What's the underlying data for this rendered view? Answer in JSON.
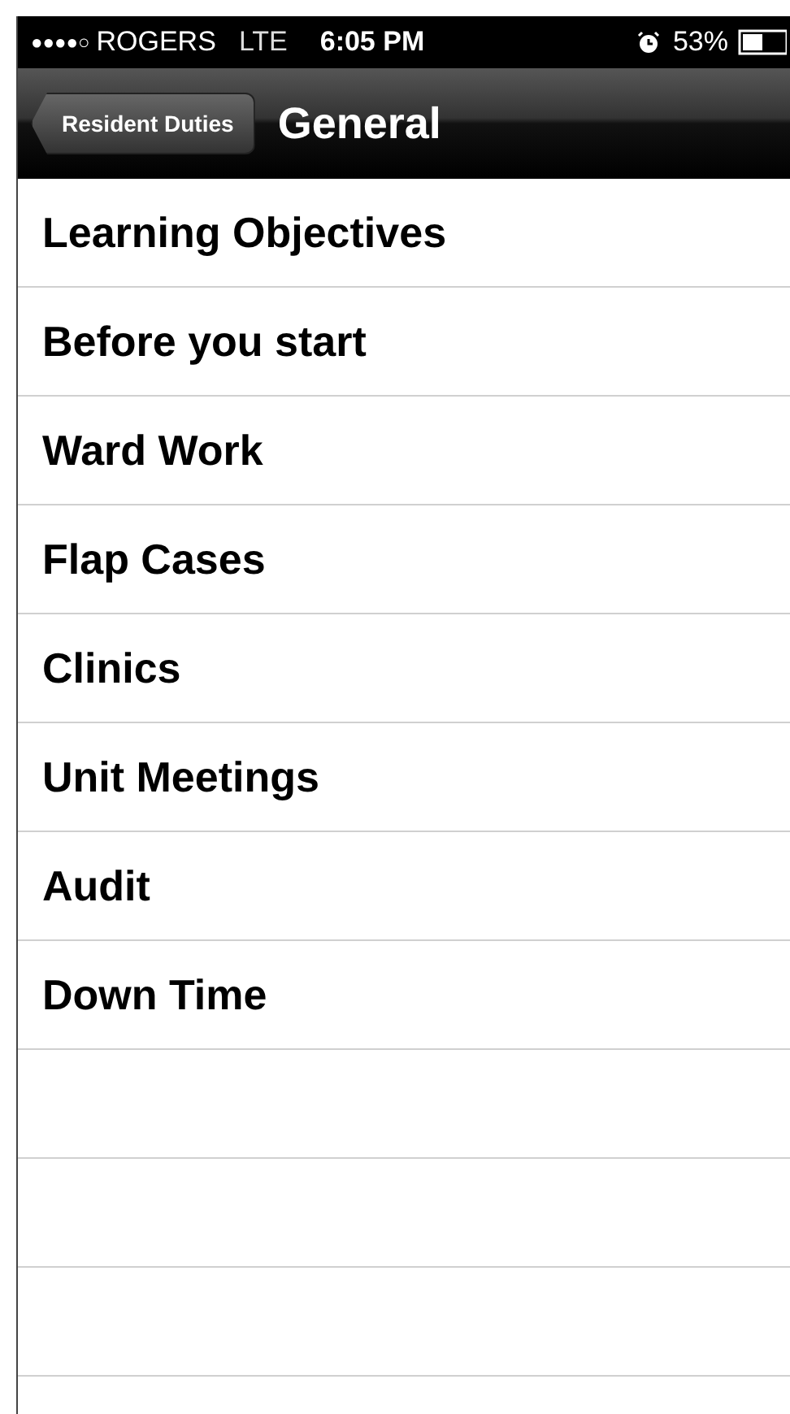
{
  "status_bar": {
    "signal": "●●●●○",
    "carrier": "ROGERS",
    "network": "LTE",
    "time": "6:05 PM",
    "battery": "53%"
  },
  "nav_bar": {
    "back_button": "Resident Duties",
    "title": "General"
  },
  "items": [
    {
      "label": "Learning Objectives"
    },
    {
      "label": "Before you start"
    },
    {
      "label": "Ward Work"
    },
    {
      "label": "Flap Cases"
    },
    {
      "label": "Clinics"
    },
    {
      "label": "Unit Meetings"
    },
    {
      "label": "Audit"
    },
    {
      "label": "Down Time"
    }
  ]
}
